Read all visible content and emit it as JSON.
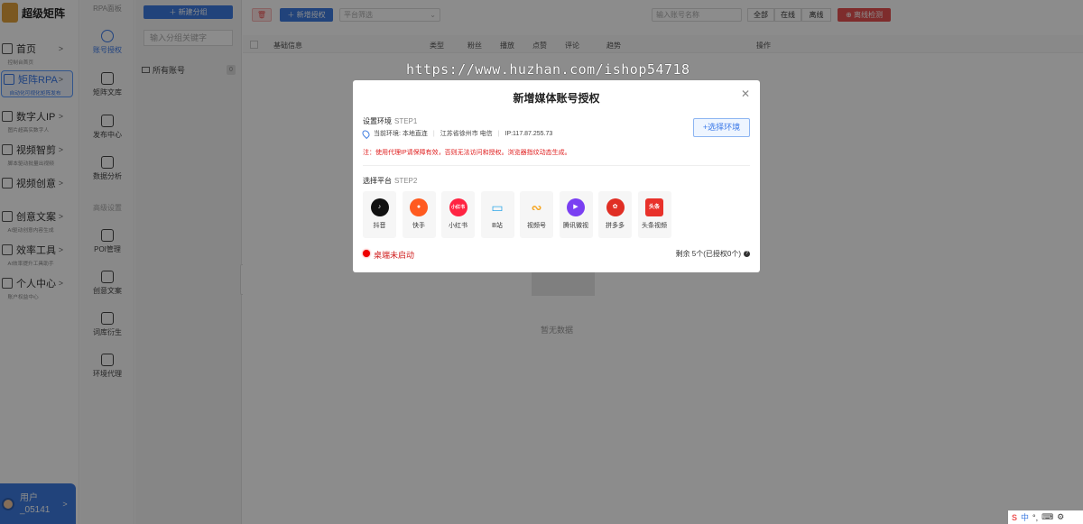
{
  "app": {
    "logo_text": "超级矩阵"
  },
  "sidebar": {
    "items": [
      {
        "label": "首页",
        "sub": "控制台首页"
      },
      {
        "label": "矩阵RPA",
        "sub": "自动化可视化矩阵发布"
      },
      {
        "label": "数字人IP",
        "sub": "图片超高实数字人"
      },
      {
        "label": "视频智剪",
        "sub": "脚本驱动批量出视频"
      },
      {
        "label": "视频创意",
        "sub": ""
      },
      {
        "label": "创意文案",
        "sub": "AI驱动创意内容生成"
      },
      {
        "label": "效率工具",
        "sub": "AI效率提升工具助手"
      },
      {
        "label": "个人中心",
        "sub": "账户权益中心"
      }
    ],
    "user": {
      "line1": "用户",
      "line2": "_05141"
    }
  },
  "rpa_panel": {
    "title": "RPA面板",
    "items": [
      "账号授权",
      "矩阵文库",
      "发布中心",
      "数据分析"
    ],
    "section": "高级设置",
    "advanced_items": [
      "POI管理",
      "创意文案",
      "词库衍生",
      "环境代理"
    ]
  },
  "groups": {
    "add_button": "＋ 新建分组",
    "search_placeholder": "输入分组关键字",
    "all_label": "所有账号",
    "all_count": "0"
  },
  "toolbar": {
    "delete_icon": "🗑",
    "add_auth": "＋ 新增授权",
    "platform_filter": "平台筛选",
    "account_search": "输入账号名称",
    "segments": [
      "全部",
      "在线",
      "离线"
    ],
    "offline_check": "⊕ 离线检测"
  },
  "table": {
    "columns": [
      "基础信息",
      "类型",
      "粉丝",
      "播放",
      "点赞",
      "评论",
      "趋势",
      "操作"
    ],
    "empty": "暂无数据"
  },
  "watermark": "https://www.huzhan.com/ishop54718",
  "modal": {
    "title": "新增媒体账号授权",
    "step1_label": "设置环境",
    "step1_tag": "STEP1",
    "env_current": "当前环境: 本地直连",
    "env_region": "江苏省徐州市 电信",
    "env_ip": "IP:117.87.255.73",
    "env_note": "注：使用代理IP请保障有效，否则无法访问和授权。浏览器指纹动态生成。",
    "select_env_btn": "+选择环境",
    "step2_label": "选择平台",
    "step2_tag": "STEP2",
    "platforms": [
      {
        "name": "抖音",
        "glyph": "♪",
        "color": "#111111"
      },
      {
        "name": "快手",
        "glyph": "●",
        "color": "#ff5a1f"
      },
      {
        "name": "小红书",
        "glyph": "小红书",
        "color": "#ff2442"
      },
      {
        "name": "B站",
        "glyph": "▭",
        "color": "#2fa8e8"
      },
      {
        "name": "视频号",
        "glyph": "∾",
        "color": "#f5a623"
      },
      {
        "name": "腾讯微视",
        "glyph": "▶",
        "color": "#7a3ff2"
      },
      {
        "name": "拼多多",
        "glyph": "✿",
        "color": "#e02e24"
      },
      {
        "name": "头条视频",
        "glyph": "头条",
        "color": "#e8312a"
      }
    ],
    "status": "桌端未启动",
    "remain": "剩余 5个(已授权0个)"
  },
  "tray": {
    "ime": "中"
  }
}
